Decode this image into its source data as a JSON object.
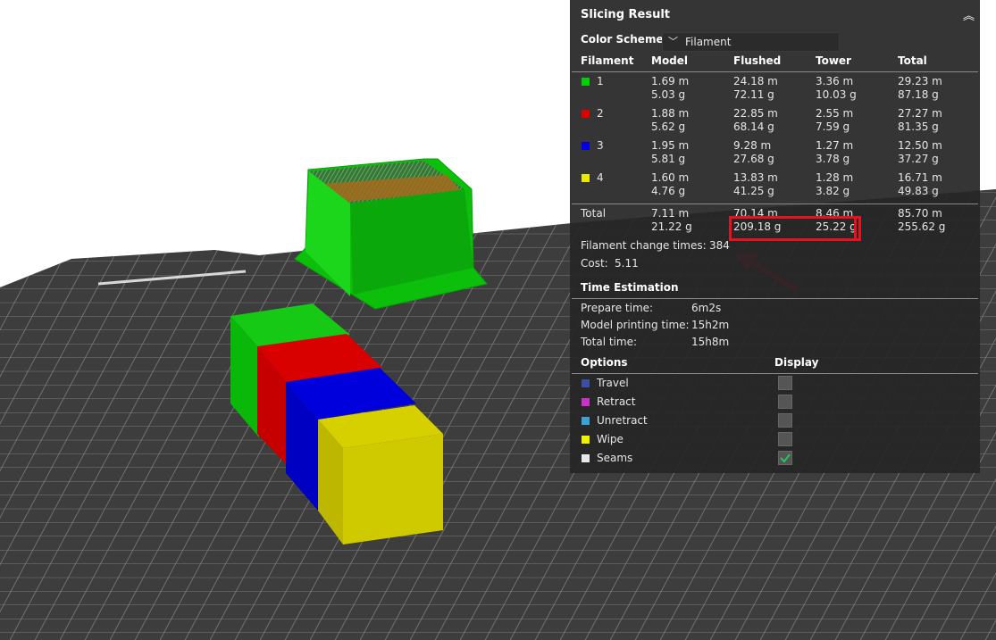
{
  "panel": {
    "title": "Slicing Result",
    "color_scheme_label": "Color Scheme",
    "color_scheme_value": "Filament",
    "columns": [
      "Filament",
      "Model",
      "Flushed",
      "Tower",
      "Total"
    ],
    "rows": [
      {
        "id": "1",
        "color": "#00d000",
        "model": [
          "1.69 m",
          "5.03 g"
        ],
        "flushed": [
          "24.18 m",
          "72.11 g"
        ],
        "tower": [
          "3.36 m",
          "10.03 g"
        ],
        "total": [
          "29.23 m",
          "87.18 g"
        ]
      },
      {
        "id": "2",
        "color": "#e00000",
        "model": [
          "1.88 m",
          "5.62 g"
        ],
        "flushed": [
          "22.85 m",
          "68.14 g"
        ],
        "tower": [
          "2.55 m",
          "7.59 g"
        ],
        "total": [
          "27.27 m",
          "81.35 g"
        ]
      },
      {
        "id": "3",
        "color": "#0000e0",
        "model": [
          "1.95 m",
          "5.81 g"
        ],
        "flushed": [
          "9.28 m",
          "27.68 g"
        ],
        "tower": [
          "1.27 m",
          "3.78 g"
        ],
        "total": [
          "12.50 m",
          "37.27 g"
        ]
      },
      {
        "id": "4",
        "color": "#e8e800",
        "model": [
          "1.60 m",
          "4.76 g"
        ],
        "flushed": [
          "13.83 m",
          "41.25 g"
        ],
        "tower": [
          "1.28 m",
          "3.82 g"
        ],
        "total": [
          "16.71 m",
          "49.83 g"
        ]
      }
    ],
    "total_row": {
      "label": "Total",
      "model": [
        "7.11 m",
        "21.22 g"
      ],
      "flushed": [
        "70.14 m",
        "209.18 g"
      ],
      "tower": [
        "8.46 m",
        "25.22 g"
      ],
      "total": [
        "85.70 m",
        "255.62 g"
      ]
    },
    "filament_change_label": "Filament change times:",
    "filament_change_value": "384",
    "cost_label": "Cost:",
    "cost_value": "5.11",
    "time_title": "Time Estimation",
    "time_rows": [
      {
        "label": "Prepare time:",
        "value": "6m2s"
      },
      {
        "label": "Model printing time:",
        "value": "15h2m"
      },
      {
        "label": "Total time:",
        "value": "15h8m"
      }
    ],
    "options_header": "Options",
    "display_header": "Display",
    "options": [
      {
        "label": "Travel",
        "color": "#3c4fa3",
        "checked": false
      },
      {
        "label": "Retract",
        "color": "#c832c8",
        "checked": false
      },
      {
        "label": "Unretract",
        "color": "#3aa3d6",
        "checked": false
      },
      {
        "label": "Wipe",
        "color": "#f0f000",
        "checked": false
      },
      {
        "label": "Seams",
        "color": "#e8e8e8",
        "checked": true
      }
    ]
  },
  "highlight_color": "#e3141b",
  "object_colors": {
    "green": "#0bbf0b",
    "red": "#cc0000",
    "blue": "#0000cc",
    "yellow": "#c8c200"
  }
}
